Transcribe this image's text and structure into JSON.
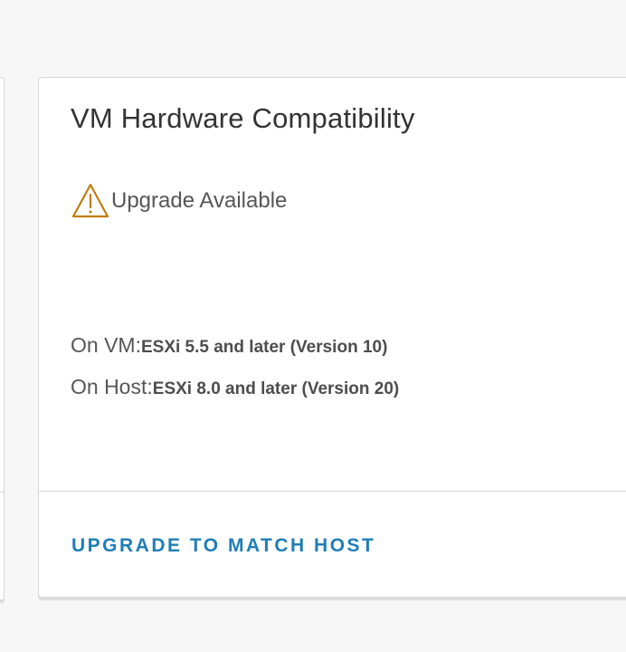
{
  "card": {
    "title": "VM Hardware Compatibility",
    "status": {
      "icon": "warning-triangle-icon",
      "icon_color": "#c27c0e",
      "label": "Upgrade Available"
    },
    "vm": {
      "key": "On VM:",
      "value": "ESXi 5.5 and later (Version 10)"
    },
    "host": {
      "key": "On Host:",
      "value": "ESXi 8.0 and later (Version 20)"
    },
    "action": {
      "label": "UPGRADE TO MATCH HOST",
      "color": "#1f7eb7"
    }
  }
}
